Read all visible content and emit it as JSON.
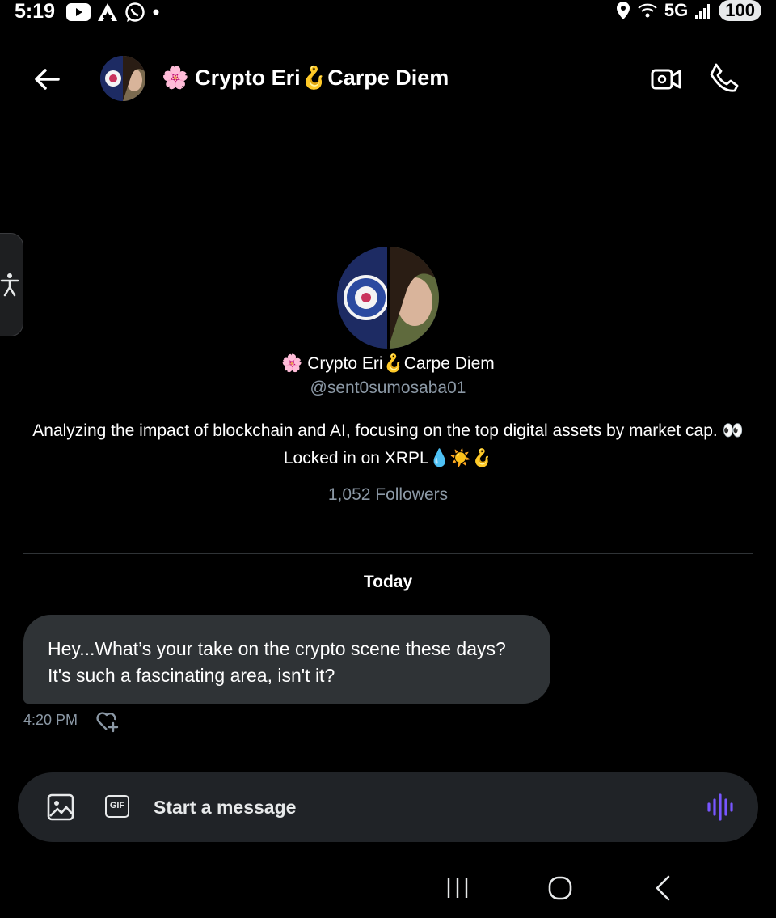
{
  "status_bar": {
    "time": "5:19",
    "network": "5G",
    "battery": "100",
    "left_icons": [
      "youtube-icon",
      "arc-icon",
      "whatsapp-icon",
      "dot-icon"
    ],
    "right_icons": [
      "location-icon",
      "wifi-icon",
      "signal-icon"
    ]
  },
  "header": {
    "title": "🌸 Crypto Eri🪝Carpe Diem",
    "icons": [
      "back-arrow-icon",
      "video-call-icon",
      "phone-icon"
    ]
  },
  "profile": {
    "name": "🌸 Crypto Eri🪝Carpe Diem",
    "handle": "@sent0sumosaba01",
    "bio": "Analyzing the impact of blockchain and AI, focusing on the top digital assets by market cap. 👀Locked in on XRPL💧☀️🪝",
    "followers": "1,052 Followers"
  },
  "conversation": {
    "date_label": "Today",
    "messages": [
      {
        "line1": "Hey...What’s your take on the crypto scene these days?",
        "line2": "It's such a fascinating area, isn't it?",
        "time": "4:20 PM"
      }
    ]
  },
  "composer": {
    "gif_label": "GIF",
    "placeholder": "Start a message",
    "voice_color": "#7856ff"
  },
  "nav": {
    "icons": [
      "recents-icon",
      "home-icon",
      "nav-back-icon"
    ]
  }
}
